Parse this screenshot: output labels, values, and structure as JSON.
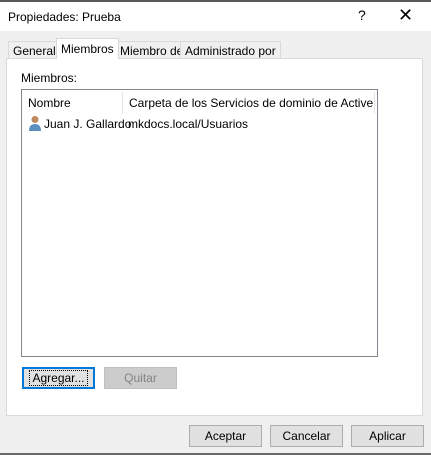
{
  "window": {
    "title": "Propiedades: Prueba",
    "help": "?",
    "close": "✕"
  },
  "tabs": [
    {
      "label": "General"
    },
    {
      "label": "Miembros",
      "active": true
    },
    {
      "label": "Miembro de"
    },
    {
      "label": "Administrado por"
    }
  ],
  "members": {
    "label": "Miembros:",
    "columns": [
      "Nombre",
      "Carpeta de los Servicios de dominio de Active Dir..."
    ],
    "rows": [
      {
        "name": "Juan J. Gallardo",
        "folder": "mkdocs.local/Usuarios",
        "icon": "user-icon"
      }
    ]
  },
  "buttons": {
    "add": "Agregar...",
    "remove": "Quitar",
    "ok": "Aceptar",
    "cancel": "Cancelar",
    "apply": "Aplicar"
  }
}
